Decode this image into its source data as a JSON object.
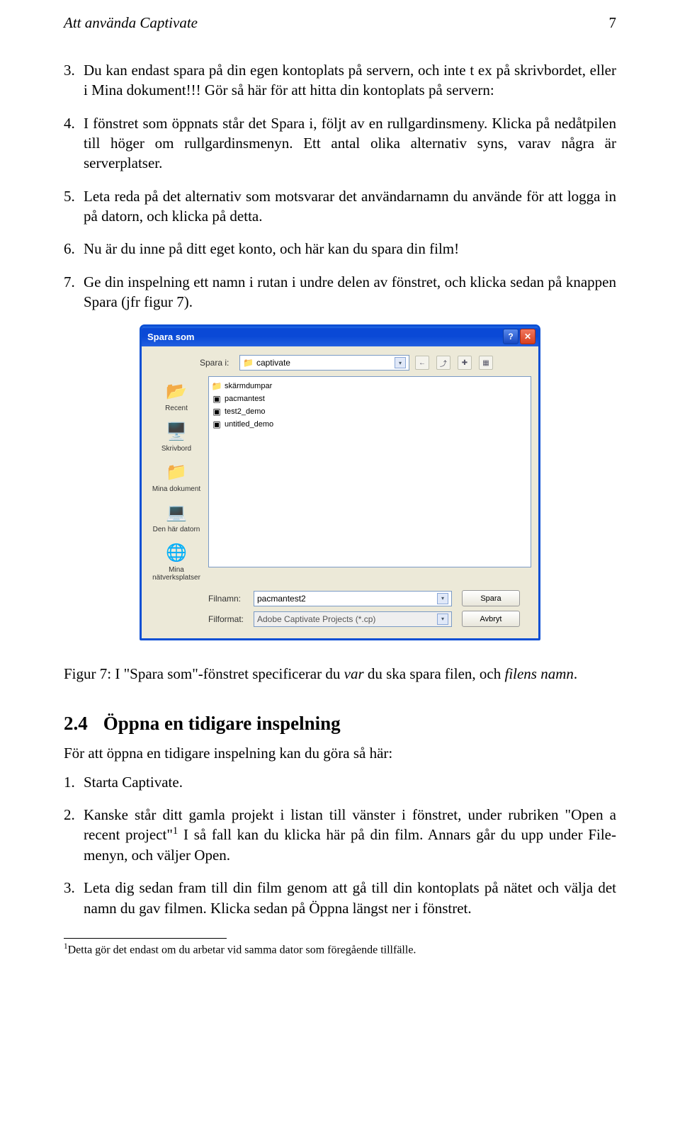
{
  "header": {
    "title": "Att använda Captivate",
    "page": "7"
  },
  "list": [
    {
      "num": "3.",
      "text": "Du kan endast spara på din egen kontoplats på servern, och inte t ex på skrivbordet, eller i Mina dokument!!! Gör så här för att hitta din kontoplats på servern:"
    },
    {
      "num": "4.",
      "text": "I fönstret som öppnats står det Spara i, följt av en rullgardinsmeny. Klicka på nedåtpilen till höger om rullgardinsmenyn. Ett antal olika alternativ syns, varav några är serverplatser."
    },
    {
      "num": "5.",
      "text": "Leta reda på det alternativ som motsvarar det användarnamn du använde för att logga in på datorn, och klicka på detta."
    },
    {
      "num": "6.",
      "text": "Nu är du inne på ditt eget konto, och här kan du spara din film!"
    },
    {
      "num": "7.",
      "text": "Ge din inspelning ett namn i rutan i undre delen av fönstret, och klicka sedan på knappen Spara (jfr figur 7)."
    }
  ],
  "dialog": {
    "title": "Spara som",
    "look_in_label": "Spara i:",
    "look_in_value": "captivate",
    "nav_icons": {
      "back": "←",
      "up": "⤴",
      "new": "✚",
      "view": "▦"
    },
    "places": [
      {
        "label": "Recent"
      },
      {
        "label": "Skrivbord"
      },
      {
        "label": "Mina dokument"
      },
      {
        "label": "Den här datorn"
      },
      {
        "label": "Mina nätverksplatser"
      }
    ],
    "files": [
      {
        "type": "folder",
        "name": "skärmdumpar"
      },
      {
        "type": "file",
        "name": "pacmantest"
      },
      {
        "type": "file",
        "name": "test2_demo"
      },
      {
        "type": "file",
        "name": "untitled_demo"
      }
    ],
    "filename_label": "Filnamn:",
    "filename_value": "pacmantest2",
    "filetype_label": "Filformat:",
    "filetype_value": "Adobe Captivate Projects (*.cp)",
    "save_btn": "Spara",
    "cancel_btn": "Avbryt"
  },
  "caption": {
    "prefix": "Figur 7: I \"Spara som\"-fönstret specificerar du ",
    "em1": "var",
    "mid": " du ska spara filen, och ",
    "em2": "filens namn",
    "suffix": "."
  },
  "section": {
    "num": "2.4",
    "title": "Öppna en tidigare inspelning",
    "intro": "För att öppna en tidigare inspelning kan du göra så här:",
    "items": [
      {
        "num": "1.",
        "text": "Starta Captivate."
      },
      {
        "num": "2.",
        "text_pre": "Kanske står ditt gamla projekt i listan till vänster i fönstret, under rubriken \"Open a recent project\"",
        "sup": "1",
        "text_post": " I så fall kan du klicka här på din film. Annars går du upp under File-menyn, och väljer Open."
      },
      {
        "num": "3.",
        "text": "Leta dig sedan fram till din film genom att gå till din kontoplats på nätet och välja det namn du gav filmen. Klicka sedan på Öppna längst ner i fönstret."
      }
    ]
  },
  "footnote": {
    "sup": "1",
    "text": "Detta gör det endast om du arbetar vid samma dator som föregående tillfälle."
  }
}
